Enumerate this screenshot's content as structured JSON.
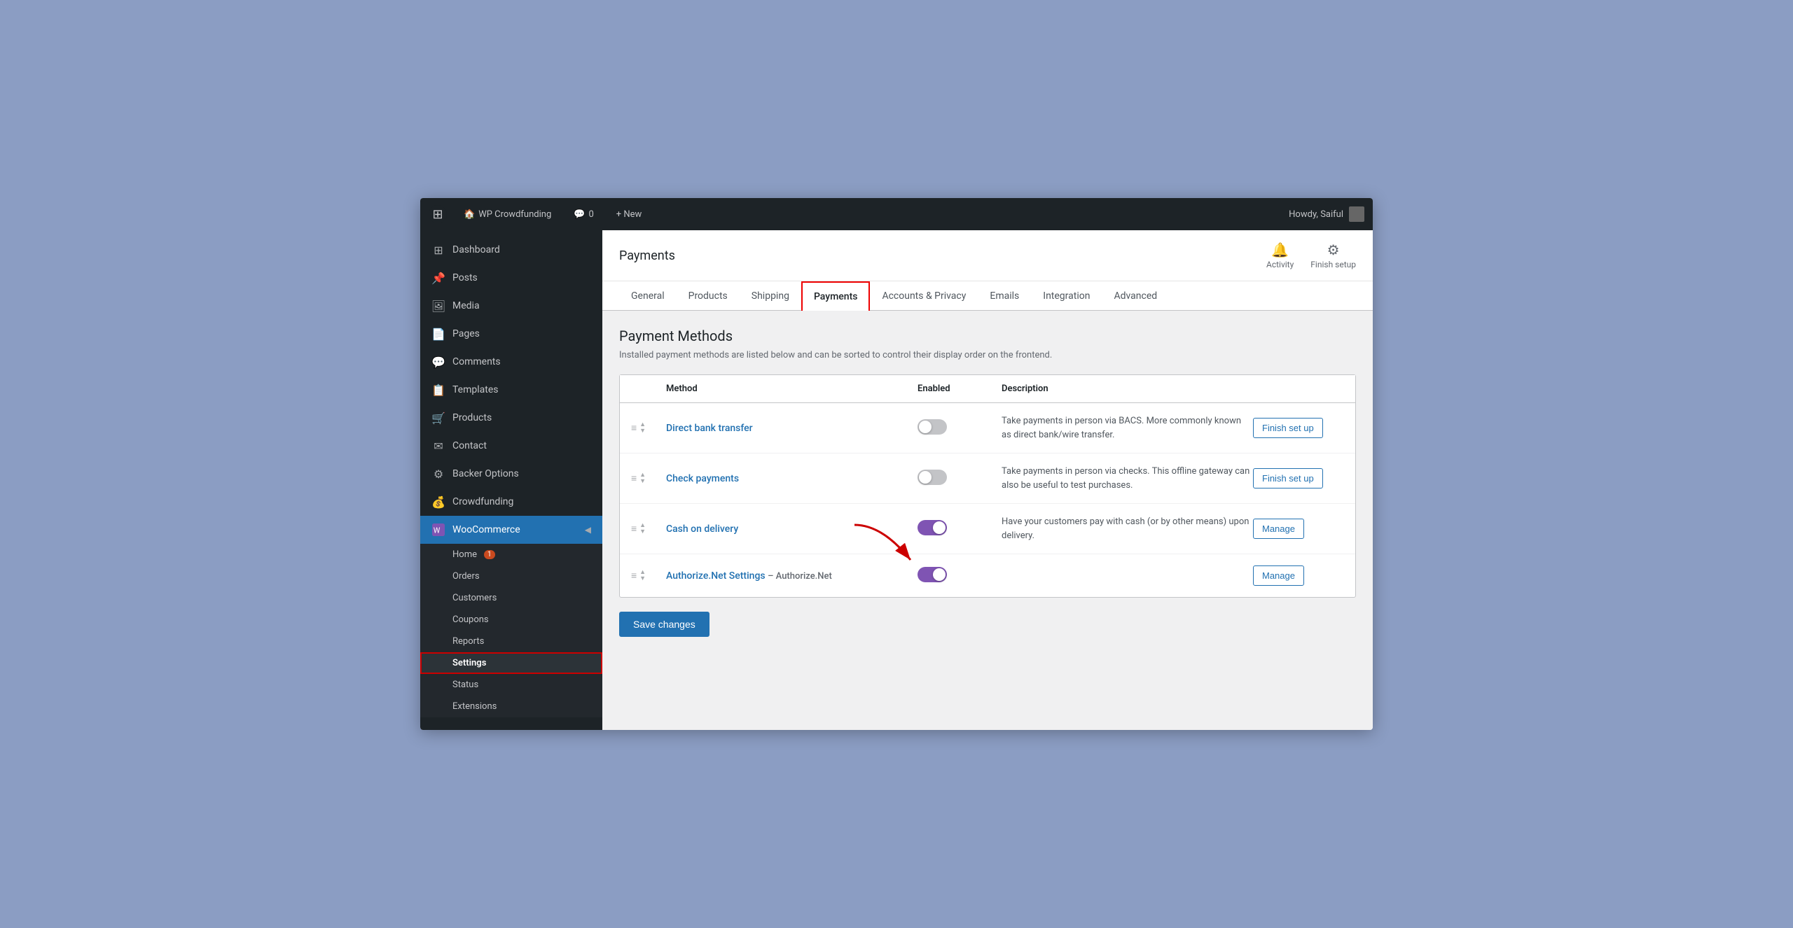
{
  "admin_bar": {
    "site_name": "WP Crowdfunding",
    "comments_count": "0",
    "new_label": "+ New",
    "howdy": "Howdy, Saiful"
  },
  "sidebar": {
    "dashboard_label": "Dashboard",
    "items": [
      {
        "id": "posts",
        "label": "Posts",
        "icon": "📌"
      },
      {
        "id": "media",
        "label": "Media",
        "icon": "🖼"
      },
      {
        "id": "pages",
        "label": "Pages",
        "icon": "📄"
      },
      {
        "id": "comments",
        "label": "Comments",
        "icon": "💬"
      },
      {
        "id": "templates",
        "label": "Templates",
        "icon": "📋"
      },
      {
        "id": "products",
        "label": "Products",
        "icon": "🛒"
      },
      {
        "id": "contact",
        "label": "Contact",
        "icon": "✉"
      },
      {
        "id": "backer-options",
        "label": "Backer Options",
        "icon": "⚙"
      },
      {
        "id": "crowdfunding",
        "label": "Crowdfunding",
        "icon": "💰"
      }
    ],
    "woocommerce_label": "WooCommerce",
    "woo_submenu": [
      {
        "id": "home",
        "label": "Home",
        "badge": "1"
      },
      {
        "id": "orders",
        "label": "Orders"
      },
      {
        "id": "customers",
        "label": "Customers"
      },
      {
        "id": "coupons",
        "label": "Coupons"
      },
      {
        "id": "reports",
        "label": "Reports"
      },
      {
        "id": "settings",
        "label": "Settings",
        "active": true
      },
      {
        "id": "status",
        "label": "Status"
      },
      {
        "id": "extensions",
        "label": "Extensions"
      }
    ]
  },
  "page": {
    "title": "Payments",
    "header_actions": [
      {
        "id": "activity",
        "label": "Activity",
        "icon": "🔔"
      },
      {
        "id": "finish-setup",
        "label": "Finish setup",
        "icon": "⚙"
      }
    ]
  },
  "tabs": [
    {
      "id": "general",
      "label": "General",
      "active": false
    },
    {
      "id": "products",
      "label": "Products",
      "active": false
    },
    {
      "id": "shipping",
      "label": "Shipping",
      "active": false
    },
    {
      "id": "payments",
      "label": "Payments",
      "active": true
    },
    {
      "id": "accounts-privacy",
      "label": "Accounts & Privacy",
      "active": false
    },
    {
      "id": "emails",
      "label": "Emails",
      "active": false
    },
    {
      "id": "integration",
      "label": "Integration",
      "active": false
    },
    {
      "id": "advanced",
      "label": "Advanced",
      "active": false
    }
  ],
  "payment_methods": {
    "section_title": "Payment Methods",
    "section_description": "Installed payment methods are listed below and can be sorted to control their display order on the frontend.",
    "table_headers": {
      "method": "Method",
      "enabled": "Enabled",
      "description": "Description"
    },
    "methods": [
      {
        "id": "direct-bank",
        "name": "Direct bank transfer",
        "subtitle": "",
        "enabled": false,
        "description": "Take payments in person via BACS. More commonly known as direct bank/wire transfer.",
        "action": "Finish set up",
        "action_type": "finish"
      },
      {
        "id": "check-payments",
        "name": "Check payments",
        "subtitle": "",
        "enabled": false,
        "description": "Take payments in person via checks. This offline gateway can also be useful to test purchases.",
        "action": "Finish set up",
        "action_type": "finish"
      },
      {
        "id": "cash-on-delivery",
        "name": "Cash on delivery",
        "subtitle": "",
        "enabled": true,
        "description": "Have your customers pay with cash (or by other means) upon delivery.",
        "action": "Manage",
        "action_type": "manage"
      },
      {
        "id": "authorize-net",
        "name": "Authorize.Net Settings",
        "subtitle": "– Authorize.Net",
        "enabled": true,
        "description": "",
        "action": "Manage",
        "action_type": "manage"
      }
    ]
  },
  "save_button": {
    "label": "Save changes"
  }
}
